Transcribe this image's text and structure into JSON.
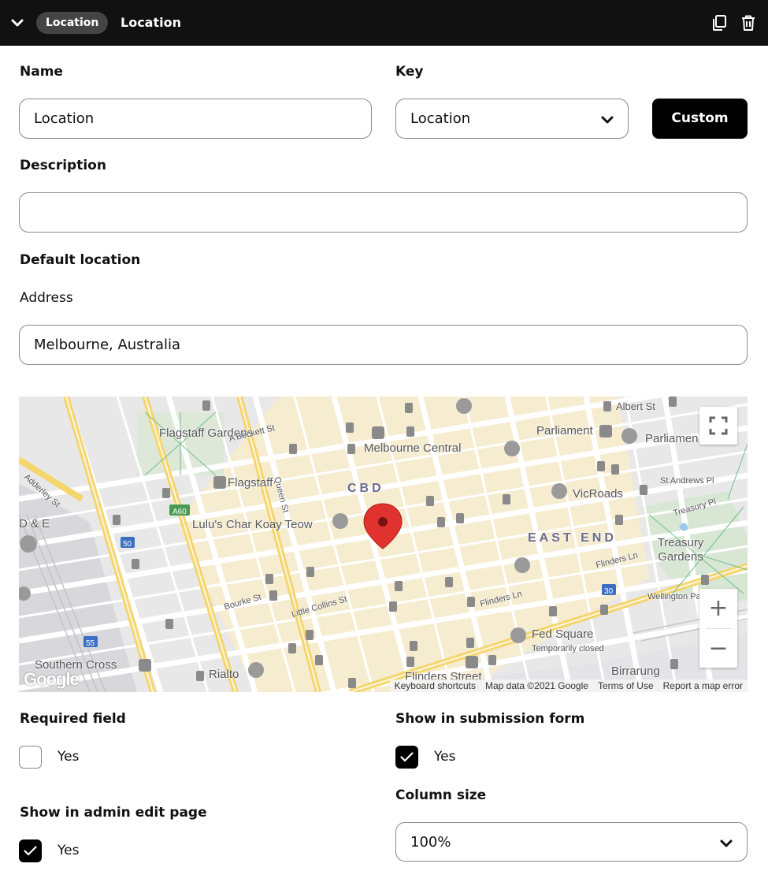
{
  "header": {
    "type_badge": "Location",
    "title": "Location"
  },
  "form": {
    "name_label": "Name",
    "name_value": "Location",
    "key_label": "Key",
    "key_value": "Location",
    "custom_button": "Custom",
    "description_label": "Description",
    "description_value": "",
    "default_location_label": "Default location",
    "address_label": "Address",
    "address_value": "Melbourne, Australia"
  },
  "map": {
    "labels": {
      "flagstaff_gardens": "Flagstaff Gardens",
      "melbourne_central": "Melbourne Central",
      "parliament": "Parliament",
      "parliament_house": "Parliamen",
      "cbd": "CBD",
      "flagstaff": "Flagstaff",
      "vicroads": "VicRoads",
      "lulus": "Lulu's Char Koay Teow",
      "east_end": "EAST END",
      "treasury_gardens": "Treasury Gardens",
      "fed_square": "Fed Square",
      "temporarily_closed": "Temporarily closed",
      "southern_cross": "Southern Cross",
      "rialto": "Rialto",
      "flinders_street": "Flinders Street",
      "birrarung": "Birrarung",
      "albert_st": "Albert St",
      "abeckett_st": "A'Beckett St",
      "queen_st": "Queen St",
      "adderley_st": "Adderley St",
      "st_andrews_pl": "St Andrews Pl",
      "treasury_pl": "Treasury Pl",
      "flinders_ln": "Flinders Ln",
      "flinders_ln_2": "Flinders Ln",
      "wellington_pa": "Wellington Pa",
      "bourke_st": "Bourke St",
      "little_collins_st": "Little Collins St",
      "d_e": "D & E",
      "a60": "A60",
      "r50": "50",
      "r55": "55",
      "r30": "30"
    },
    "attribution": [
      "Keyboard shortcuts",
      "Map data ©2021 Google",
      "Terms of Use",
      "Report a map error"
    ],
    "logo": "Google",
    "zoom_in": "+",
    "zoom_out": "−"
  },
  "options": {
    "required_label": "Required field",
    "required_yes": "Yes",
    "required_checked": false,
    "submission_label": "Show in submission form",
    "submission_yes": "Yes",
    "submission_checked": true,
    "admin_label": "Show in admin edit page",
    "admin_yes": "Yes",
    "admin_checked": true,
    "column_size_label": "Column size",
    "column_size_value": "100%"
  },
  "colors": {
    "header_bg": "#111111",
    "badge_bg": "#444444",
    "button_bg": "#000000",
    "pin": "#d9302c",
    "map_yellow_road": "#f8d974",
    "map_bg": "#e9e9e9"
  }
}
